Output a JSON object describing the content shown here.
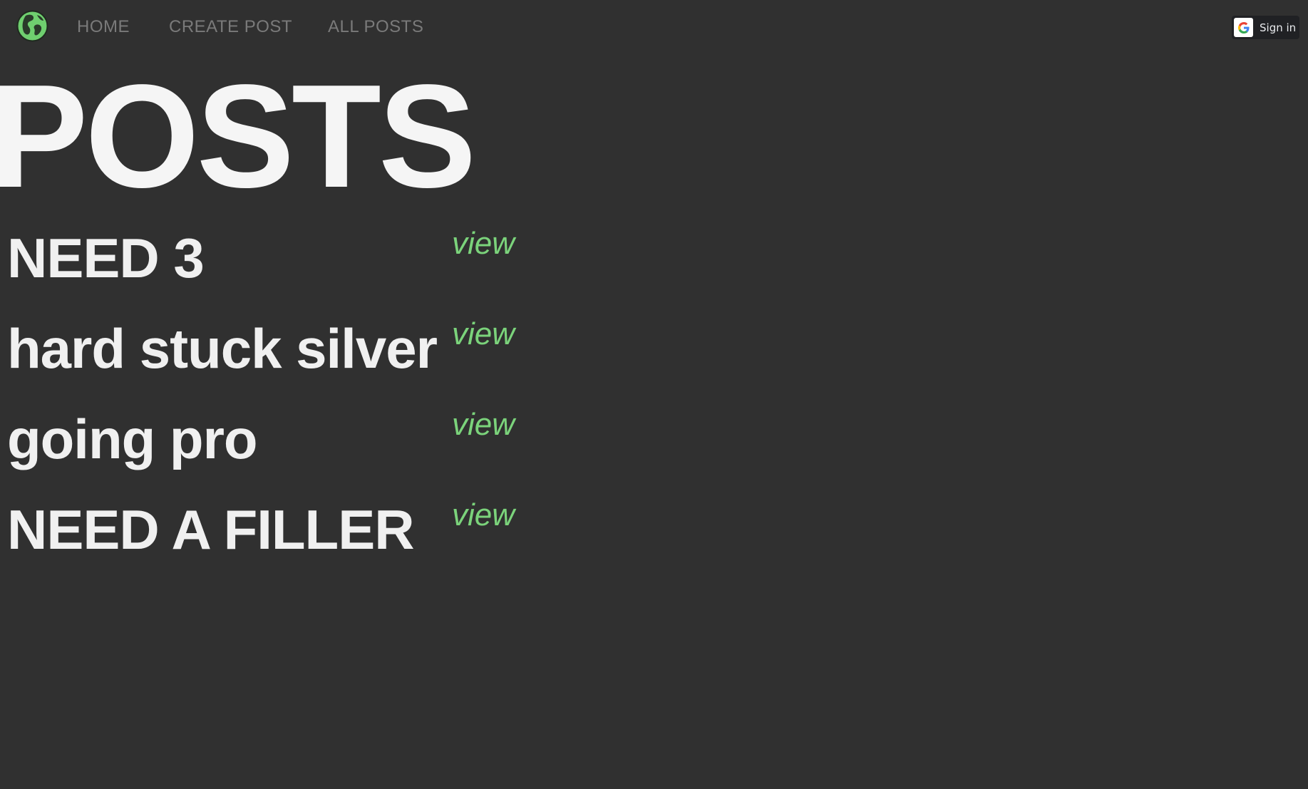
{
  "nav": {
    "links": [
      "HOME",
      "CREATE POST",
      "ALL POSTS"
    ],
    "signin_label": "Sign in"
  },
  "page": {
    "title": "POSTS"
  },
  "posts": [
    {
      "title": "NEED 3",
      "link_label": "view"
    },
    {
      "title": "hard stuck silver",
      "link_label": "view"
    },
    {
      "title": "going pro",
      "link_label": "view"
    },
    {
      "title": "NEED A FILLER",
      "link_label": "view"
    }
  ],
  "colors": {
    "background": "#303030",
    "accent": "#7bd37b",
    "nav_text": "#7a7a7a",
    "title_text": "#f5f5f5"
  },
  "icons": {
    "logo": "globe-icon",
    "signin": "google-icon"
  }
}
